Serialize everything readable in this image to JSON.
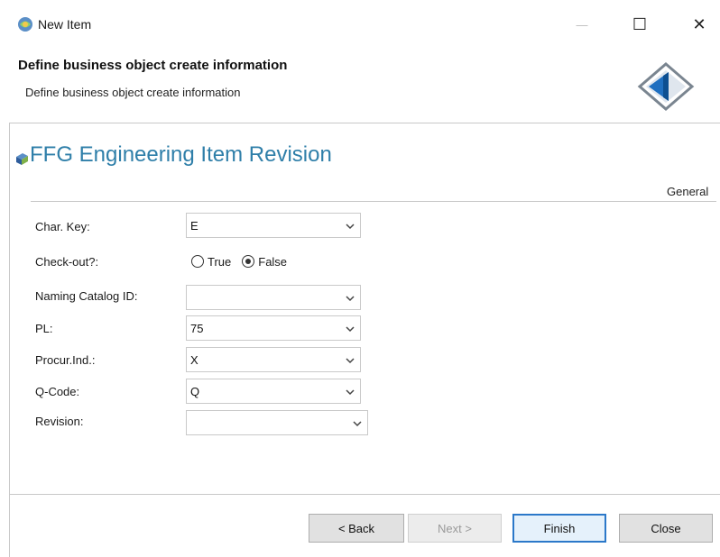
{
  "window": {
    "title": "New Item",
    "minimize_glyph": "—",
    "maximize_glyph": "☐",
    "close_glyph": "✕"
  },
  "header": {
    "title": "Define business object create information",
    "subtitle": "Define business object create information"
  },
  "form": {
    "title": "FFG Engineering Item Revision",
    "tab_label": "General",
    "fields": [
      {
        "label": "Char. Key:",
        "value": "E"
      },
      {
        "label": "Check-out?:",
        "options": [
          "True",
          "False"
        ],
        "selected": "False"
      },
      {
        "label": "Naming Catalog ID:",
        "value": ""
      },
      {
        "label": "PL:",
        "value": "75"
      },
      {
        "label": "Procur.Ind.:",
        "value": "X"
      },
      {
        "label": "Q-Code:",
        "value": "Q"
      },
      {
        "label": "Revision:",
        "value": ""
      }
    ]
  },
  "buttons": {
    "back": "< Back",
    "next": "Next >",
    "finish": "Finish",
    "close": "Close"
  },
  "colors": {
    "accent": "#2f7fa9",
    "default_button_border": "#2b78c9"
  },
  "icons": [
    "app-icon",
    "wizard-banner-icon",
    "business-object-icon",
    "dropdown-arrow-icon"
  ]
}
